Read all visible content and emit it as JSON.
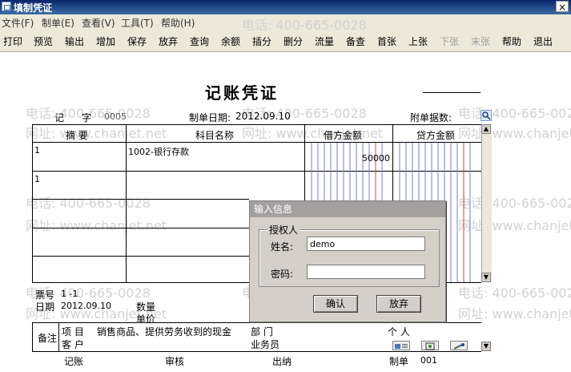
{
  "window": {
    "title": "填制凭证",
    "close_glyph": "×"
  },
  "menu": [
    {
      "label": "文件(F)"
    },
    {
      "label": "制单(E)"
    },
    {
      "label": "查看(V)"
    },
    {
      "label": "工具(T)"
    },
    {
      "label": "帮助(H)"
    }
  ],
  "toolbar": [
    {
      "label": "打印"
    },
    {
      "label": "预览"
    },
    {
      "label": "输出"
    },
    {
      "label": "增加"
    },
    {
      "label": "保存"
    },
    {
      "label": "放弃"
    },
    {
      "label": "查询"
    },
    {
      "label": "余额"
    },
    {
      "label": "插分"
    },
    {
      "label": "删分"
    },
    {
      "label": "流量"
    },
    {
      "label": "备查"
    },
    {
      "label": "首张"
    },
    {
      "label": "上张"
    },
    {
      "label": "下张",
      "disabled": true
    },
    {
      "label": "末张",
      "disabled": true
    },
    {
      "label": "帮助"
    },
    {
      "label": "退出"
    }
  ],
  "watermark": {
    "phone": "电话: 400-665-0028",
    "site": "网址: www.chanjet.net"
  },
  "voucher": {
    "title": "记账凭证",
    "type_label": "记",
    "zi_label": "字",
    "number": "0005",
    "date_label": "制单日期:",
    "date": "2012.09.10",
    "attach_label": "附单据数:",
    "columns": {
      "summary": "摘 要",
      "account": "科目名称",
      "debit": "借方金额",
      "credit": "贷方金额"
    },
    "rows": [
      {
        "summary": "1",
        "account": "1002-银行存款",
        "debit": "50000",
        "credit": ""
      },
      {
        "summary": "1",
        "account": "",
        "debit": "",
        "credit": ""
      },
      {
        "summary": "",
        "account": "",
        "debit": "",
        "credit": ""
      },
      {
        "summary": "",
        "account": "",
        "debit": "",
        "credit": ""
      },
      {
        "summary": "",
        "account": "",
        "debit": "",
        "credit": ""
      }
    ],
    "ticket_label": "票号",
    "ticket_value": "1  -1",
    "date2_label": "日期",
    "date2_value": "2012.09.10",
    "qty_label": "数量",
    "price_label": "单价",
    "remarks_label": "备注",
    "project_label": "项  目",
    "project_value": "销售商品、提供劳务收到的现金",
    "customer_label": "客  户",
    "dept_label": "部  门",
    "person_label": "个  人",
    "salesman_label": "业务员",
    "sign": [
      {
        "label": "记账"
      },
      {
        "label": "审核"
      },
      {
        "label": "出纳"
      },
      {
        "label": "制单",
        "value": "001"
      }
    ]
  },
  "dialog": {
    "title": "输入信息",
    "group_label": "授权人",
    "name_label": "姓名:",
    "name_value": "demo",
    "password_label": "密码:",
    "password_value": "",
    "ok": "确认",
    "cancel": "放弃"
  }
}
